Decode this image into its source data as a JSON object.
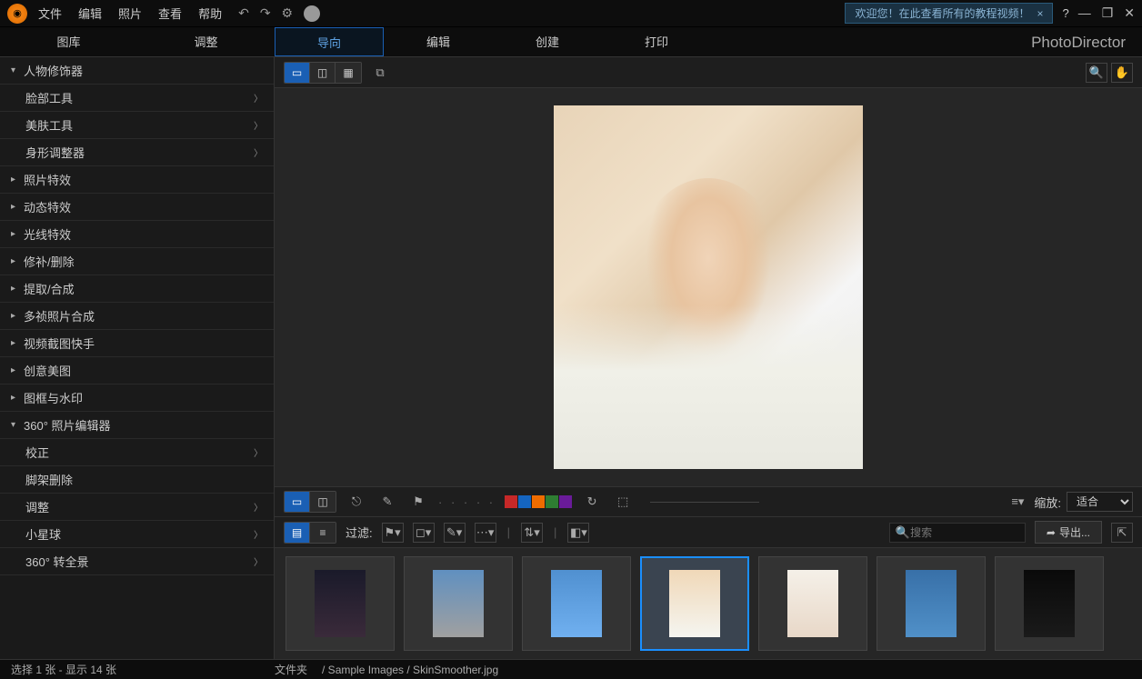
{
  "menu": {
    "file": "文件",
    "edit": "编辑",
    "photo": "照片",
    "view": "查看",
    "help": "帮助"
  },
  "tutorial": {
    "text": "欢迎您！在此查看所有的教程视频！",
    "close": "×"
  },
  "win": {
    "help": "?",
    "min": "—",
    "max": "❐",
    "close": "✕"
  },
  "modes": {
    "library": "图库",
    "adjust": "调整",
    "guided": "导向",
    "edit": "编辑",
    "create": "创建",
    "print": "打印"
  },
  "brand": "PhotoDirector",
  "sidebar": [
    {
      "label": "人物修饰器",
      "expanded": true,
      "sub": [
        {
          "label": "脸部工具",
          "chev": true
        },
        {
          "label": "美肤工具",
          "chev": true
        },
        {
          "label": "身形调整器",
          "chev": true
        }
      ]
    },
    {
      "label": "照片特效"
    },
    {
      "label": "动态特效"
    },
    {
      "label": "光线特效"
    },
    {
      "label": "修补/删除"
    },
    {
      "label": "提取/合成"
    },
    {
      "label": "多祯照片合成"
    },
    {
      "label": "视频截图快手"
    },
    {
      "label": "创意美图"
    },
    {
      "label": "图框与水印"
    },
    {
      "label": "360° 照片编辑器",
      "expanded": true,
      "sub": [
        {
          "label": "校正",
          "chev": true
        },
        {
          "label": "脚架删除"
        },
        {
          "label": "调整",
          "chev": true
        },
        {
          "label": "小星球",
          "chev": true
        },
        {
          "label": "360° 转全景",
          "chev": true
        }
      ]
    }
  ],
  "palette": [
    "#c62828",
    "#1565c0",
    "#ef6c00",
    "#2e7d32",
    "#6a1b9a"
  ],
  "zoom": {
    "label": "缩放:",
    "value": "适合"
  },
  "filter": {
    "label": "过滤:"
  },
  "search": {
    "placeholder": "搜索"
  },
  "export": {
    "label": "导出..."
  },
  "status": {
    "selection": "选择 1 张 - 显示 14 张",
    "folder_label": "文件夹",
    "path": "/ Sample Images / SkinSmoother.jpg"
  },
  "thumbs": [
    {
      "bg": "linear-gradient(180deg,#1a1a2a,#3a2a3a)",
      "inner": "#c44"
    },
    {
      "bg": "linear-gradient(180deg,#6090c0,#a0a0a0)",
      "inner": "#eee"
    },
    {
      "bg": "linear-gradient(180deg,#5090d0,#70b0f0)",
      "inner": "#c85"
    },
    {
      "bg": "linear-gradient(180deg,#f0d8b8,#f5f5f0)",
      "inner": "#e8c8a8",
      "selected": true
    },
    {
      "bg": "linear-gradient(180deg,#f5f0e8,#e8d8c8)",
      "inner": "#f0d8c0"
    },
    {
      "bg": "linear-gradient(180deg,#3870a8,#5090c8)",
      "inner": "#a0c0e0"
    },
    {
      "bg": "linear-gradient(180deg,#0a0a0a,#1a1a1a)",
      "inner": "#d8a850"
    }
  ]
}
